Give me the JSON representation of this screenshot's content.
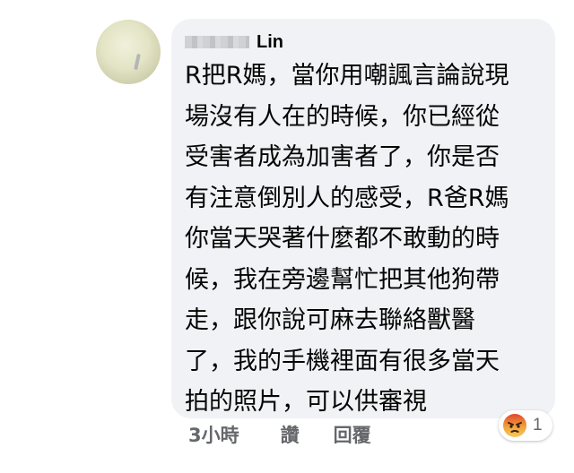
{
  "comment": {
    "author_name": "Lin",
    "text_lines": [
      "R把R媽，當你用嘲諷言論說現",
      "場沒有人在的時候，你已經從",
      "受害者成為加害者了，你是否",
      "有注意倒別人的感受，R爸R媽",
      "你當天哭著什麼都不敢動的時",
      "候，我在旁邊幫忙把其他狗帶",
      "走，跟你說可麻去聯絡獸醫",
      "了，我的手機裡面有很多當天",
      "拍的照片，可以供審視"
    ]
  },
  "actions": {
    "timestamp": "3小時",
    "like_label": "讚",
    "reply_label": "回覆"
  },
  "reactions": {
    "icon": "angry-face-icon",
    "count": "1",
    "color": "#f0a23b"
  },
  "colors": {
    "bubble": "#f0f2f5",
    "action_text": "#65676b",
    "text": "#050505"
  }
}
